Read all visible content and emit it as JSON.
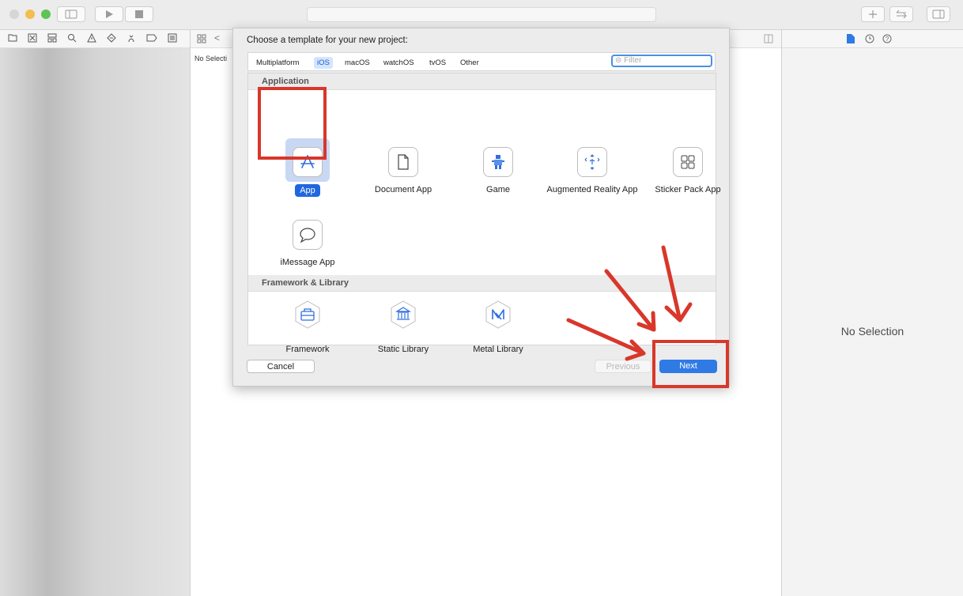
{
  "window": {
    "activity_bar": "",
    "toolbar_icons": [
      "sidebar-toggle-icon",
      "run-icon",
      "stop-icon",
      "library-plus-icon",
      "code-review-icon",
      "inspector-toggle-icon"
    ]
  },
  "navigator_toolbar": {
    "icons": [
      "folder-icon",
      "source-control-icon",
      "symbol-icon",
      "find-icon",
      "issue-icon",
      "test-icon",
      "debug-icon",
      "breakpoint-icon",
      "report-icon"
    ]
  },
  "editor": {
    "jump_bar_back": "<",
    "no_selection_truncated": "No Selecti"
  },
  "inspector": {
    "tabs": [
      "file-inspector-icon",
      "history-icon",
      "help-icon"
    ],
    "no_selection": "No Selection"
  },
  "sheet": {
    "title": "Choose a template for your new project:",
    "platform_tabs": [
      {
        "label": "Multiplatform",
        "selected": false
      },
      {
        "label": "iOS",
        "selected": true
      },
      {
        "label": "macOS",
        "selected": false
      },
      {
        "label": "watchOS",
        "selected": false
      },
      {
        "label": "tvOS",
        "selected": false
      },
      {
        "label": "Other",
        "selected": false
      }
    ],
    "filter_placeholder": "Filter",
    "sections": [
      {
        "title": "Application",
        "templates": [
          {
            "label": "App",
            "icon": "app-store-icon",
            "selected": true
          },
          {
            "label": "Document App",
            "icon": "document-icon",
            "selected": false
          },
          {
            "label": "Game",
            "icon": "game-sprite-icon",
            "selected": false
          },
          {
            "label": "Augmented Reality App",
            "icon": "ar-cube-icon",
            "selected": false
          },
          {
            "label": "Sticker Pack App",
            "icon": "sticker-grid-icon",
            "selected": false
          },
          {
            "label": "iMessage App",
            "icon": "message-bubble-icon",
            "selected": false
          }
        ]
      },
      {
        "title": "Framework & Library",
        "templates": [
          {
            "label": "Framework",
            "icon": "toolbox-icon"
          },
          {
            "label": "Static Library",
            "icon": "bank-icon"
          },
          {
            "label": "Metal Library",
            "icon": "metal-icon"
          }
        ]
      }
    ],
    "buttons": {
      "cancel": "Cancel",
      "previous": "Previous",
      "next": "Next"
    }
  },
  "colors": {
    "accent": "#2f7ae5",
    "annotation_red": "#d8372a",
    "selected_tab_bg": "#d5e5fb"
  }
}
